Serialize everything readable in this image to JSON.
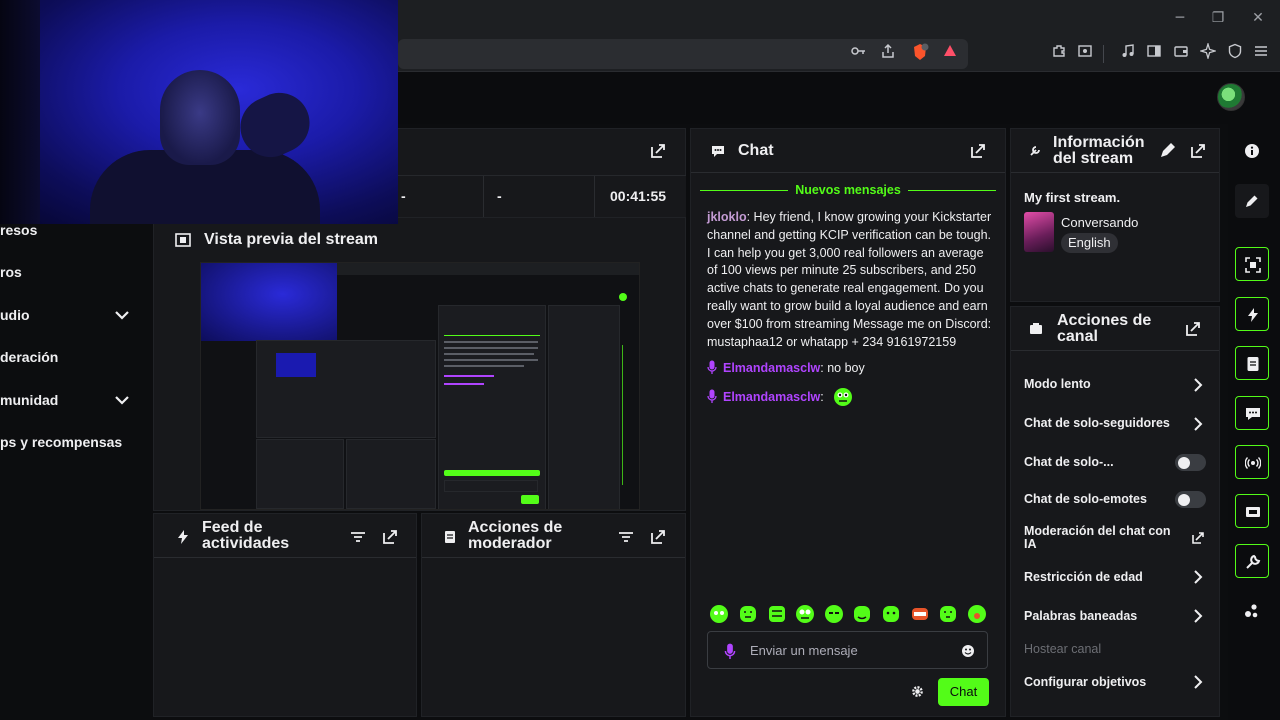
{
  "browser": {
    "window_controls": {
      "minimize": "─",
      "maximize": "❐",
      "close": "✕"
    }
  },
  "sidebar": {
    "items": [
      {
        "label": "resos",
        "has_chevron": false
      },
      {
        "label": "ros",
        "has_chevron": false
      },
      {
        "label": "udio",
        "has_chevron": true
      },
      {
        "label": "deración",
        "has_chevron": false
      },
      {
        "label": "munidad",
        "has_chevron": true
      },
      {
        "label": "ps y recompensas",
        "has_chevron": false
      }
    ]
  },
  "stats": {
    "col2": "-",
    "col3": "-",
    "uptime": "00:41:55"
  },
  "preview": {
    "title": "Vista previa del stream"
  },
  "feed": {
    "title_line1": "Feed de",
    "title_line2": "actividades"
  },
  "mod_actions": {
    "title_line1": "Acciones de",
    "title_line2": "moderador"
  },
  "chat": {
    "title": "Chat",
    "new_messages_label": "Nuevos mensajes",
    "messages": [
      {
        "user": "jkloklo",
        "user_color": "#c39bd3",
        "text": ": Hey friend, I know growing your Kickstarter channel and getting KCIP verification can be tough. I can help you get 3,000 real followers an average of 100 views per minute 25 subscribers, and 250 active chats to generate real engagement. Do you really want to grow build a loyal audience and earn over $100 from streaming Message me on Discord: mustaphaa12 or whatapp + 234 9161972159"
      },
      {
        "user": "Elmandamasclw",
        "user_color": "#b044ff",
        "text": ": no boy"
      },
      {
        "user": "Elmandamasclw",
        "user_color": "#b044ff",
        "text": ":"
      }
    ],
    "input_placeholder": "Enviar un mensaje",
    "send_label": "Chat",
    "accent_color": "#53fc18"
  },
  "stream_info": {
    "title_line1": "Información",
    "title_line2": "del stream",
    "stream_title": "My first stream.",
    "category": "Conversando",
    "language": "English"
  },
  "channel_actions": {
    "title_line1": "Acciones de",
    "title_line2": "canal",
    "items": [
      {
        "label": "Modo lento",
        "control": "chevron"
      },
      {
        "label": "Chat de solo-seguidores",
        "control": "chevron"
      },
      {
        "label": "Chat de solo-...",
        "control": "toggle",
        "enabled": false
      },
      {
        "label": "Chat de solo-emotes",
        "control": "toggle",
        "enabled": false
      },
      {
        "label_line1": "Moderación del chat con",
        "label_line2": "IA",
        "control": "external"
      },
      {
        "label": "Restricción de edad",
        "control": "chevron"
      },
      {
        "label": "Palabras baneadas",
        "control": "chevron"
      },
      {
        "label": "Hostear canal",
        "control": "none",
        "disabled": true
      },
      {
        "label": "Configurar objetivos",
        "control": "chevron"
      }
    ]
  }
}
